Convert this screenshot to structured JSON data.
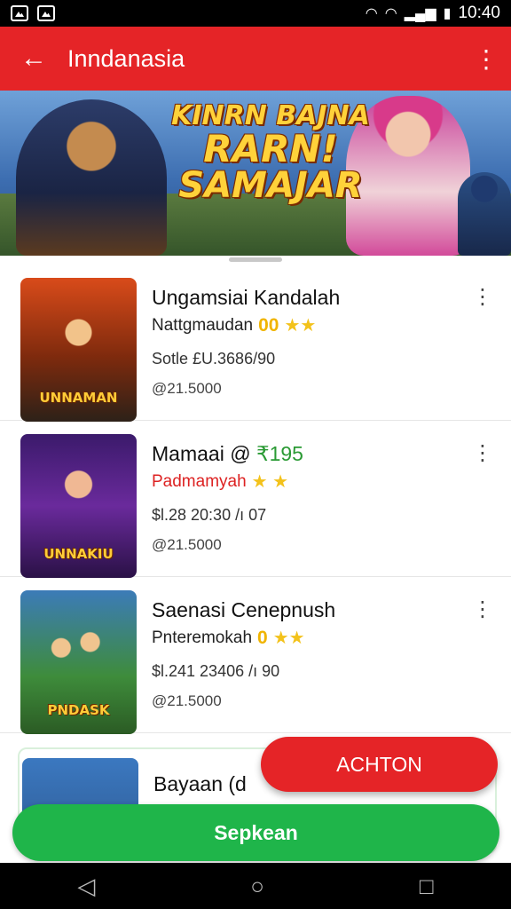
{
  "status_bar": {
    "time": "10:40"
  },
  "app_bar": {
    "title": "Inndanasia",
    "back_icon": "arrow-left-icon",
    "menu_icon": "more-vert-icon"
  },
  "banner": {
    "line1": "KINRN BAJNA",
    "line2": "RARN!",
    "line3": "SAMAJAR"
  },
  "items": [
    {
      "name": "Ungamsiai Kandalah",
      "name_green": "",
      "subtitle": "Nattgmaudan",
      "rating": "00",
      "stars": "★★",
      "price": "Sotle £U.3686/90",
      "installs": "@21.5000",
      "logo": "UNNAMAN"
    },
    {
      "name": "Mamaai @",
      "name_green": "₹195",
      "subtitle": "Padmamyah",
      "rating": "",
      "stars": "★ ★",
      "price": "$l.28 20:30 /ı 07",
      "installs": "@21.5000",
      "logo": "UNNAKIU"
    },
    {
      "name": "Saenasi Cenepnush",
      "name_green": "",
      "subtitle": "Pnteremokah",
      "rating": "0",
      "stars": "★★",
      "price": "$l.241 23406 /ı 90",
      "installs": "@21.5000",
      "logo": "PNDASK"
    },
    {
      "name": "Bayaan (d",
      "name_green": "",
      "subtitle": "",
      "rating": "",
      "stars": "",
      "price": "",
      "installs": "",
      "logo": ""
    }
  ],
  "fab_label": "ACHTON",
  "cta_label": "Sepkean",
  "nav": {
    "back": "back-icon",
    "home": "home-icon",
    "recents": "recents-icon"
  }
}
